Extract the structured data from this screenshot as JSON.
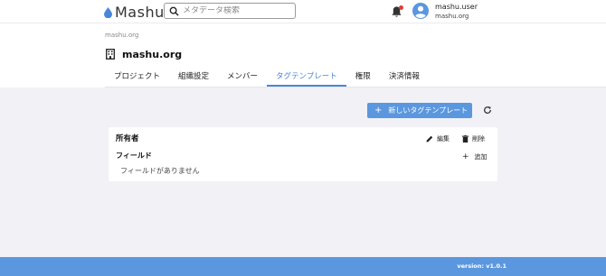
{
  "header": {
    "brand": "Mashu",
    "search_placeholder": "メタデータ検索",
    "user": {
      "name": "mashu.user",
      "org": "mashu.org"
    },
    "notification_badge_color": "#e53935"
  },
  "breadcrumb": "mashu.org",
  "org_title": "mashu.org",
  "tabs": [
    {
      "label": "プロジェクト"
    },
    {
      "label": "組織設定"
    },
    {
      "label": "メンバー"
    },
    {
      "label": "タグテンプレート",
      "active": true
    },
    {
      "label": "権限"
    },
    {
      "label": "決済情報"
    }
  ],
  "toolbar": {
    "new_template_label": "新しいタグテンプレート"
  },
  "template_card": {
    "title": "所有者",
    "edit_label": "編集",
    "delete_label": "削除",
    "fields_heading": "フィールド",
    "add_label": "追加",
    "empty_message": "フィールドがありません"
  },
  "footer": {
    "version": "version: v1.0.1"
  },
  "colors": {
    "accent": "#5b97de",
    "active_tab": "#4a86d8"
  }
}
